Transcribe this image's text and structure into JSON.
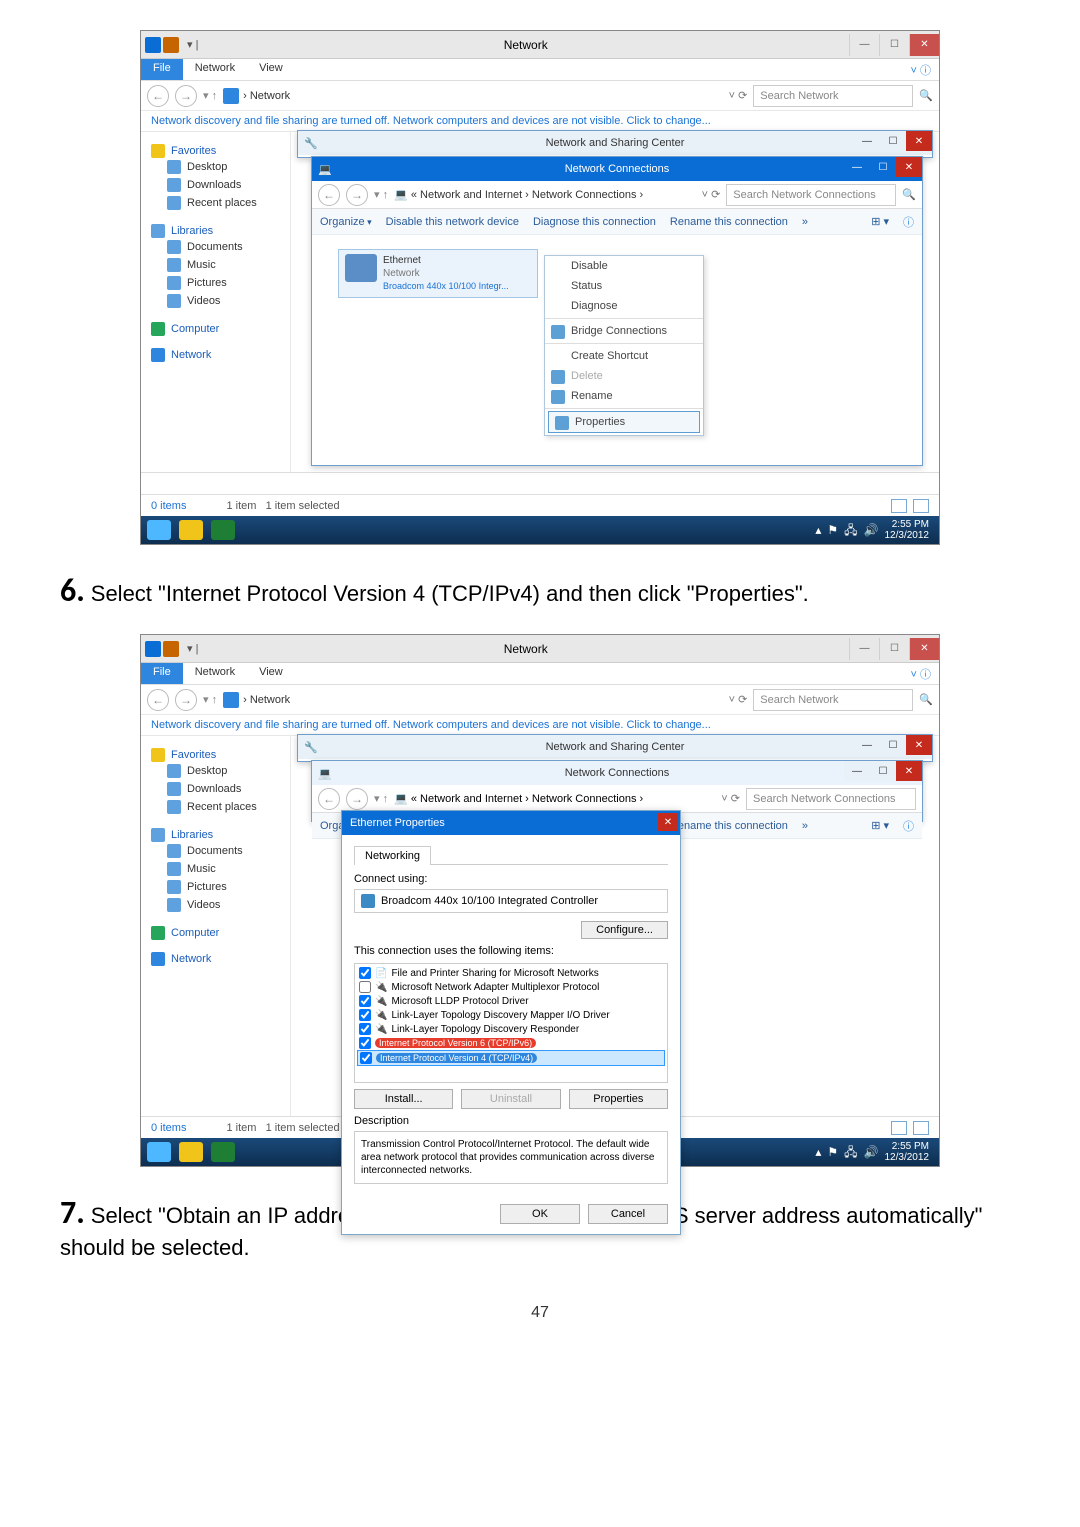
{
  "page_number": "47",
  "step6": "Select \"Internet Protocol Version 4 (TCP/IPv4) and then click \"Properties\".",
  "step7": "Select \"Obtain an IP address automatically\" and \"Obtain DNS server address automatically\" should be selected.",
  "shot1": {
    "window_title": "Network",
    "menubar": {
      "file": "File",
      "network": "Network",
      "view": "View"
    },
    "addr_path": "Network",
    "search_placeholder": "Search Network",
    "info_msg": "Network discovery and file sharing are turned off. Network computers and devices are not visible. Click to change...",
    "sidebar": {
      "favorites": "Favorites",
      "items_fav": [
        "Desktop",
        "Downloads",
        "Recent places"
      ],
      "libraries": "Libraries",
      "items_lib": [
        "Documents",
        "Music",
        "Pictures",
        "Videos"
      ],
      "computer": "Computer",
      "network": "Network"
    },
    "sharing_title": "Network and Sharing Center",
    "conn_title": "Network Connections",
    "conn_path_prefix": "« Network and Internet › Network Connections ›",
    "conn_search": "Search Network Connections",
    "toolbar": {
      "organize": "Organize",
      "disable": "Disable this network device",
      "diagnose": "Diagnose this connection",
      "rename": "Rename this connection",
      "more": "»"
    },
    "adapter": {
      "name": "Ethernet",
      "net": "Network",
      "dev": "Broadcom 440x 10/100 Integr..."
    },
    "ctx": [
      "Disable",
      "Status",
      "Diagnose",
      "Bridge Connections",
      "Create Shortcut",
      "Delete",
      "Rename",
      "Properties"
    ],
    "status": {
      "left": "0 items",
      "count": "1 item",
      "sel": "1 item selected"
    },
    "time": "2:55 PM",
    "date": "12/3/2012"
  },
  "shot2": {
    "dialog_title": "Ethernet Properties",
    "tab": "Networking",
    "connect_label": "Connect using:",
    "adapter_name": "Broadcom 440x 10/100 Integrated Controller",
    "configure_btn": "Configure...",
    "uses_label": "This connection uses the following items:",
    "items": [
      "File and Printer Sharing for Microsoft Networks",
      "Microsoft Network Adapter Multiplexor Protocol",
      "Microsoft LLDP Protocol Driver",
      "Link-Layer Topology Discovery Mapper I/O Driver",
      "Link-Layer Topology Discovery Responder",
      "Internet Protocol Version 6 (TCP/IPv6)",
      "Internet Protocol Version 4 (TCP/IPv4)"
    ],
    "btns": {
      "install": "Install...",
      "uninstall": "Uninstall",
      "properties": "Properties"
    },
    "desc_label": "Description",
    "desc_text": "Transmission Control Protocol/Internet Protocol. The default wide area network protocol that provides communication across diverse interconnected networks.",
    "ok": "OK",
    "cancel": "Cancel"
  }
}
